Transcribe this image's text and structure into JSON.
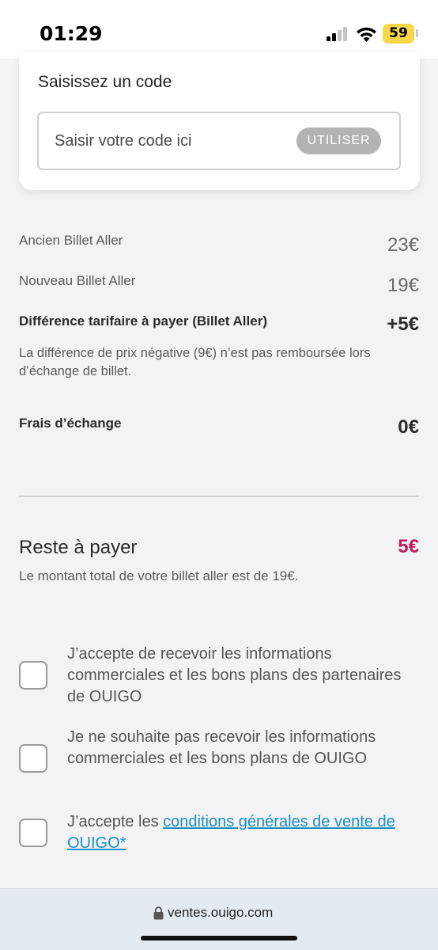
{
  "status_bar": {
    "time": "01:29",
    "battery": "59",
    "battery_color": "#f6d64a"
  },
  "promo": {
    "title": "Saisissez un code",
    "input_placeholder": "Saisir votre code ici",
    "input_value": "",
    "button_label": "UTILISER"
  },
  "pricing": {
    "old_ticket_label": "Ancien Billet Aller",
    "old_ticket_value": "23€",
    "new_ticket_label": "Nouveau Billet Aller",
    "new_ticket_value": "19€",
    "difference_label": "Différence tarifaire à payer (Billet Aller)",
    "difference_value": "+5€",
    "note": "La différence de prix négative (9€) n’est pas remboursée lors d’échange de billet.",
    "fees_label": "Frais d’échange",
    "fees_value": "0€"
  },
  "summary": {
    "remaining_label": "Reste à payer",
    "remaining_value": "5€",
    "remaining_color": "#c2185b",
    "total_note": "Le montant total de votre billet aller est de 19€."
  },
  "consents": {
    "partners": {
      "text": "J’accepte de recevoir les informations commerciales et les bons plans des partenaires de OUIGO",
      "checked": false
    },
    "optout": {
      "text": "Je ne souhaite pas recevoir les informations commerciales et les bons plans de OUIGO",
      "checked": false
    },
    "terms": {
      "prefix": "J’accepte les ",
      "link": "conditions générales de vente de OUIGO*",
      "checked": false
    },
    "link_color": "#1a8fc0"
  },
  "browser": {
    "url": "ventes.ouigo.com"
  }
}
